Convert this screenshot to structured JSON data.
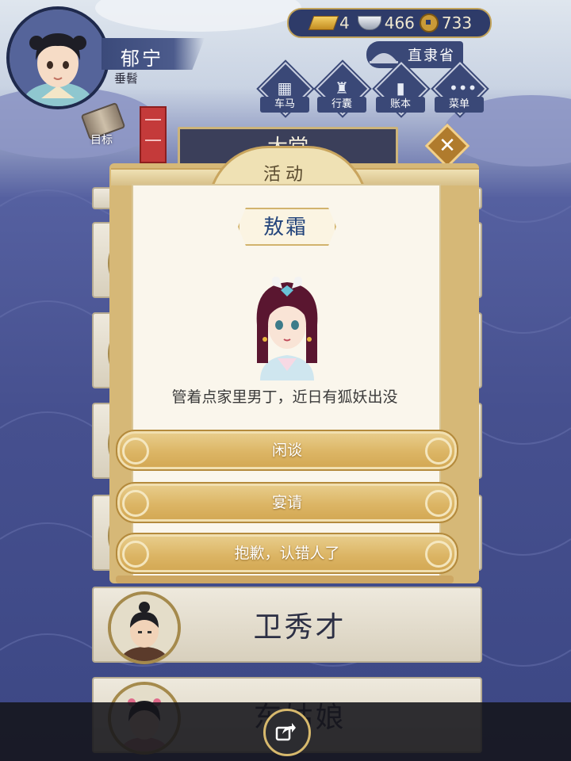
{
  "player": {
    "name": "郁宁",
    "title": "垂髫"
  },
  "currency": {
    "gold": "4",
    "silver": "466",
    "coins": "733"
  },
  "location": {
    "name": "直隶省"
  },
  "menu": [
    {
      "label": "车马",
      "icon": "carriage-icon"
    },
    {
      "label": "行囊",
      "icon": "bag-icon"
    },
    {
      "label": "账本",
      "icon": "ledger-icon"
    },
    {
      "label": "菜单",
      "icon": "more-icon"
    }
  ],
  "goal": {
    "label": "目标"
  },
  "behind_panel": {
    "title": "大堂"
  },
  "list": [
    {
      "name": "卫秀才"
    },
    {
      "name": "东姑娘"
    }
  ],
  "dialog": {
    "title": "活动",
    "npc_name": "敖霜",
    "npc_line": "管着点家里男丁，近日有狐妖出没",
    "options": [
      "闲谈",
      "宴请",
      "抱歉，认错人了"
    ]
  }
}
